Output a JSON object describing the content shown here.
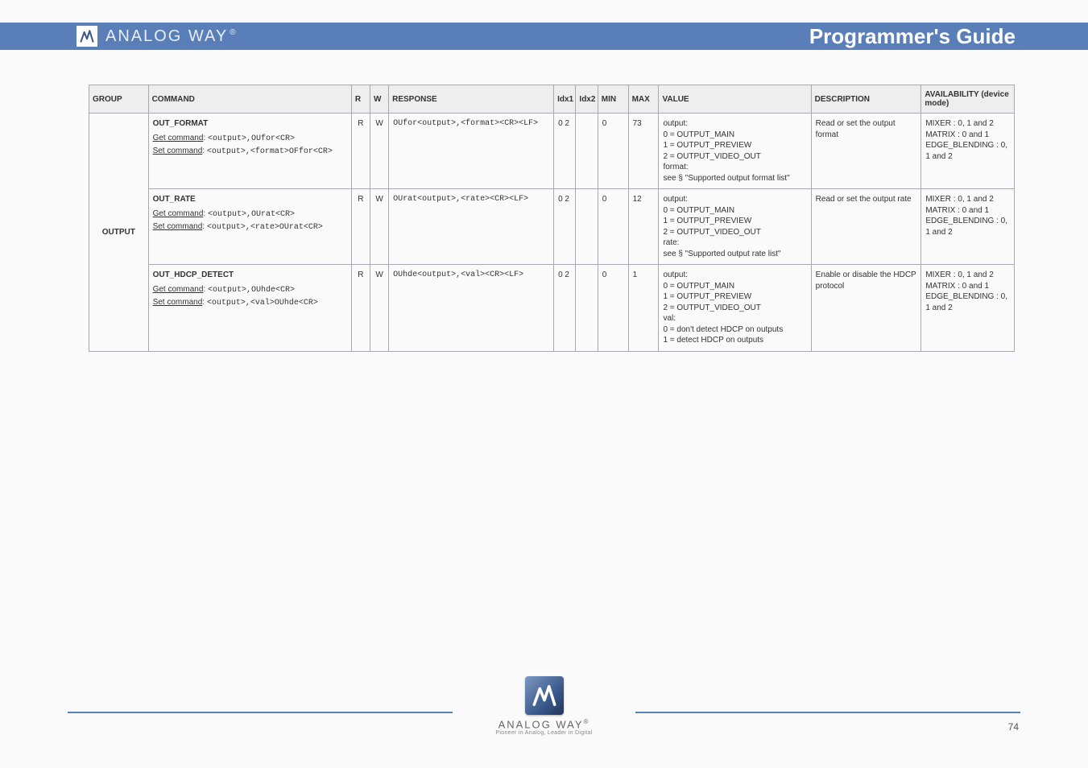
{
  "header": {
    "brand": "ANALOG WAY",
    "reg": "®",
    "title": "Programmer's Guide"
  },
  "table": {
    "headers": {
      "group": "GROUP",
      "command": "COMMAND",
      "r": "R",
      "w": "W",
      "response": "RESPONSE",
      "idx1": "Idx1",
      "idx2": "Idx2",
      "min": "MIN",
      "max": "MAX",
      "value": "VALUE",
      "description": "DESCRIPTION",
      "avail": "AVAILABILITY (device mode)"
    },
    "group_label": "OUTPUT",
    "rows": [
      {
        "command_name": "OUT_FORMAT",
        "command_get": "<output>,OUfor<CR>",
        "command_set": "<output>,<format>OFfor<CR>",
        "r": "R",
        "w": "W",
        "response": "OUfor<output>,<format><CR><LF>",
        "idx1": "0 2",
        "idx2": "",
        "min": "0",
        "max": "73",
        "value": "output:\n  0 = OUTPUT_MAIN\n  1 = OUTPUT_PREVIEW\n  2 = OUTPUT_VIDEO_OUT\nformat:\n  see § \"Supported output format list\"",
        "description": "Read or set the output format",
        "avail": "MIXER : 0, 1 and 2\nMATRIX : 0 and 1\nEDGE_BLENDING : 0, 1 and 2"
      },
      {
        "command_name": "OUT_RATE",
        "command_get": "<output>,OUrat<CR>",
        "command_set": "<output>,<rate>OUrat<CR>",
        "r": "R",
        "w": "W",
        "response": "OUrat<output>,<rate><CR><LF>",
        "idx1": "0 2",
        "idx2": "",
        "min": "0",
        "max": "12",
        "value": "output:\n  0 = OUTPUT_MAIN\n  1 = OUTPUT_PREVIEW\n  2 = OUTPUT_VIDEO_OUT\nrate:\n  see § \"Supported output rate list\"",
        "description": "Read or set the output rate",
        "avail": "MIXER : 0, 1 and 2\nMATRIX : 0 and 1\nEDGE_BLENDING : 0, 1 and 2"
      },
      {
        "command_name": "OUT_HDCP_DETECT",
        "command_get": "<output>,OUhde<CR>",
        "command_set": "<output>,<val>OUhde<CR>",
        "r": "R",
        "w": "W",
        "response": "OUhde<output>,<val><CR><LF>",
        "idx1": "0 2",
        "idx2": "",
        "min": "0",
        "max": "1",
        "value": "output:\n  0 = OUTPUT_MAIN\n  1 = OUTPUT_PREVIEW\n  2 = OUTPUT_VIDEO_OUT\nval:\n  0 = don't detect HDCP on outputs\n  1 = detect HDCP on outputs",
        "description": "Enable or disable the HDCP protocol",
        "avail": "MIXER : 0, 1 and 2\nMATRIX : 0 and 1\nEDGE_BLENDING : 0, 1 and 2"
      }
    ]
  },
  "footer": {
    "brand": "ANALOG WAY",
    "reg": "®",
    "tagline": "Pioneer in Analog, Leader in Digital",
    "page": "74"
  }
}
